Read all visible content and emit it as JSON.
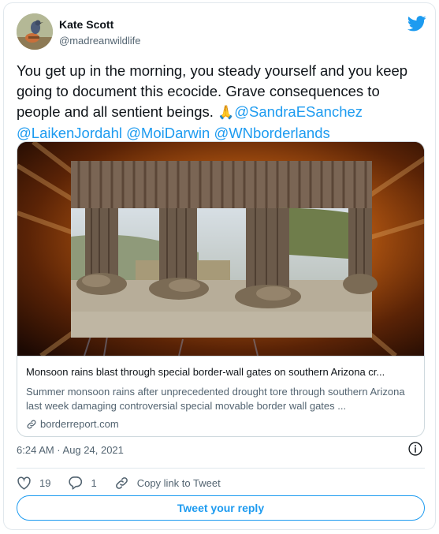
{
  "author": {
    "name": "Kate Scott",
    "handle": "@madreanwildlife",
    "avatar_icon": "bird-avatar-icon",
    "platform_icon": "twitter-bird-icon"
  },
  "tweet": {
    "text": "You get up in the morning, you steady yourself and you keep going to document this ecocide. Grave consequences to people and all sentient beings.",
    "emoji": "🙏",
    "mentions": [
      "@SandraESanchez",
      "@LaikenJordahl",
      "@MoiDarwin",
      "@WNborderlands"
    ]
  },
  "link_card": {
    "title": "Monsoon rains blast through special border-wall gates on southern Arizona cr...",
    "description": "Summer monsoon rains after unprecedented drought tore through southern Arizona last week damaging controversial special movable border wall gates ...",
    "domain": "borderreport.com",
    "domain_icon": "link-icon"
  },
  "timestamp": "6:24 AM · Aug 24, 2021",
  "info_icon": "info-icon",
  "actions": {
    "like_count": "19",
    "reply_count": "1",
    "copy_link_label": "Copy link to Tweet"
  },
  "reply_button_label": "Tweet your reply",
  "colors": {
    "accent": "#1d9bf0",
    "text": "#0f1419",
    "secondary": "#536471",
    "border": "#cfd9de"
  }
}
